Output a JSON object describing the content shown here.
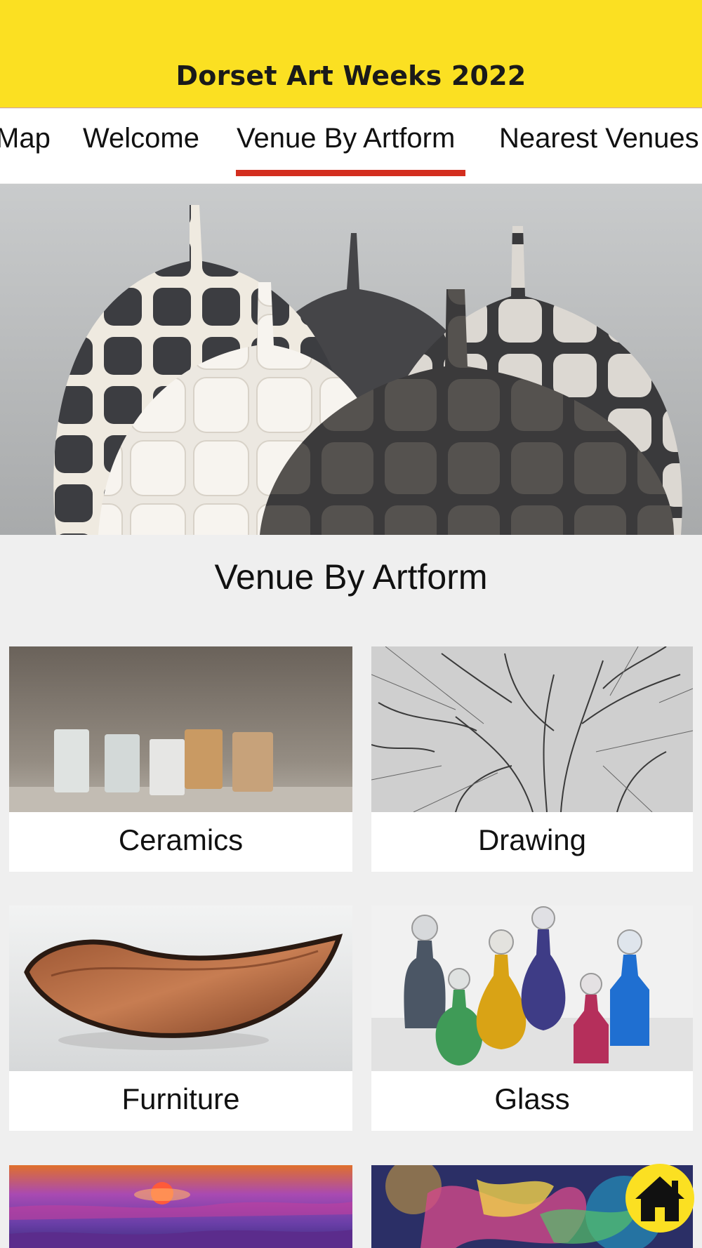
{
  "header": {
    "title": "Dorset Art Weeks 2022"
  },
  "tabs": [
    {
      "label": "Map",
      "active": false
    },
    {
      "label": "Welcome",
      "active": false
    },
    {
      "label": "Venue By Artform",
      "active": true
    },
    {
      "label": "Nearest Venues",
      "active": false
    }
  ],
  "section": {
    "title": "Venue By Artform"
  },
  "cards": [
    {
      "label": "Ceramics"
    },
    {
      "label": "Drawing"
    },
    {
      "label": "Furniture"
    },
    {
      "label": "Glass"
    },
    {
      "label": ""
    },
    {
      "label": ""
    }
  ],
  "colors": {
    "header_bg": "#fbe022",
    "tab_indicator": "#d32e1f",
    "page_bg": "#efefef"
  },
  "icons": {
    "home_button": "home-icon"
  }
}
